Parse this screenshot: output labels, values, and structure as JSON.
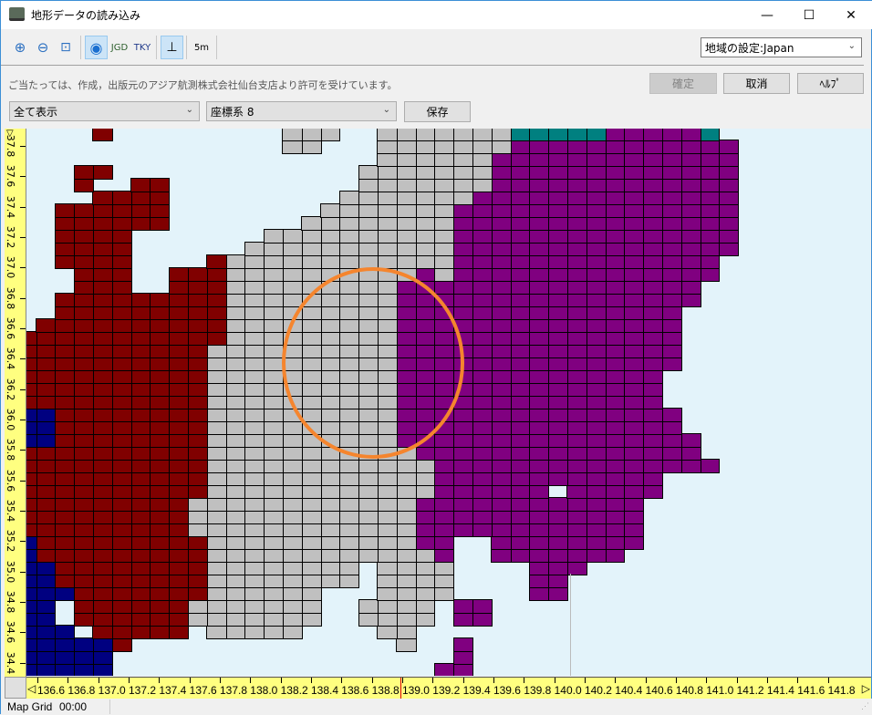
{
  "window": {
    "title": "地形データの読み込み",
    "minimize": "—",
    "maximize": "☐",
    "close": "✕"
  },
  "toolbar": {
    "jgd": "JGD",
    "tky": "TKY",
    "scale": "5m",
    "region_select": "地域の設定:Japan"
  },
  "notice": "ご当たっては、作成，出版元のアジア航測株式会社仙台支店より許可を受けています。",
  "buttons": {
    "confirm": "確定",
    "cancel": "取消",
    "help": "ﾍﾙﾌﾟ",
    "save": "保存"
  },
  "filters": {
    "display": "全て表示",
    "coord_system": "座標系 8"
  },
  "colors": {
    "water": "#e3f3fa",
    "R": "#800000",
    "G": "#c0c0c0",
    "P": "#800080",
    "B": "#000080",
    "T": "#008080",
    "circle": "#f5852e"
  },
  "map_rows": [
    "R4,G14-16,G19-25,T26-30,P31-35,T36",
    "G14-15,G19-25,P26-37",
    "G19-24,P25-37",
    "R3-4,G18-24,P25-37",
    "R3,R6-7,G18-24,P25-37",
    "R4-7,G17-23,P24-37",
    "R2-7,G16-22,P23-37",
    "R2-7,G15-22,P23-37",
    "R2-5,G13-22,P23-37",
    "R2-5,G12-22,P23-37",
    "R2-5,R10,G11-22,P23-36",
    "R3-5,R8-10,G11-20,P21,G22,P23-36",
    "R3-5,R8-10,G11-19,P20-35",
    "R2-10,G11-19,P20-35",
    "R2-10,G11-19,P20-34",
    "R1-10,G11-19,P20-34",
    "R0-10,G11-19,P20-34",
    "R0-9,G10-19,P20-34",
    "R0-9,G10-19,P20-34",
    "R0-9,G10-19,P20-33",
    "R0-9,G10-19,P20-33",
    "R0-9,G10-19,P20-33",
    "B0-1,R2-9,G10-19,P20-34",
    "B0-1,R2-9,G10-19,P20-34",
    "B0-1,R2-9,G10-19,P20-35",
    "R0-9,G10-20,P21-35",
    "R0-9,G10-21,P22-36",
    "R0-9,G10-21,P22-33",
    "R0-9,G10-21,P22-27,P29-33",
    "R0-8,G9-20,P21-32",
    "R0-8,G9-20,P21-32",
    "R0-8,G9-20,P21-32",
    "B0,R1-9,G10-20,P21-22,P25-32",
    "B0,R1-9,G10-21,P22,P25-31",
    "B0-1,R2-9,G10-17,G19-22,P27-29",
    "B0-1,R2-9,G10-17,G19-22,P27-28",
    "B0-2,R3-9,G10-15,G19-22,P27-28",
    "B0-1,R3-8,G9-15,G18-21,P23-24",
    "B0-1,R3-8,G9-15,G18-21,P23-24",
    "B0-2,R4-8,G10-14,G19-20",
    "B0-4,R5,G20,P23",
    "B0-4,P23",
    "B0-4,P22-23"
  ],
  "lat_labels": [
    "37.8",
    "37.6",
    "37.4",
    "37.2",
    "37.0",
    "36.8",
    "36.6",
    "36.4",
    "36.2",
    "36.0",
    "35.8",
    "35.6",
    "35.4",
    "35.2",
    "35.0",
    "34.8",
    "34.6",
    "34.4"
  ],
  "lon_labels": [
    "136.6",
    "136.8",
    "137.0",
    "137.2",
    "137.4",
    "137.6",
    "137.8",
    "138.0",
    "138.2",
    "138.4",
    "138.6",
    "138.8",
    "139.0",
    "139.2",
    "139.4",
    "139.6",
    "139.8",
    "140.0",
    "140.2",
    "140.4",
    "140.6",
    "140.8",
    "141.0",
    "141.2",
    "141.4",
    "141.6",
    "141.8"
  ],
  "status": {
    "mode": "Map Grid",
    "time": "00:00"
  }
}
